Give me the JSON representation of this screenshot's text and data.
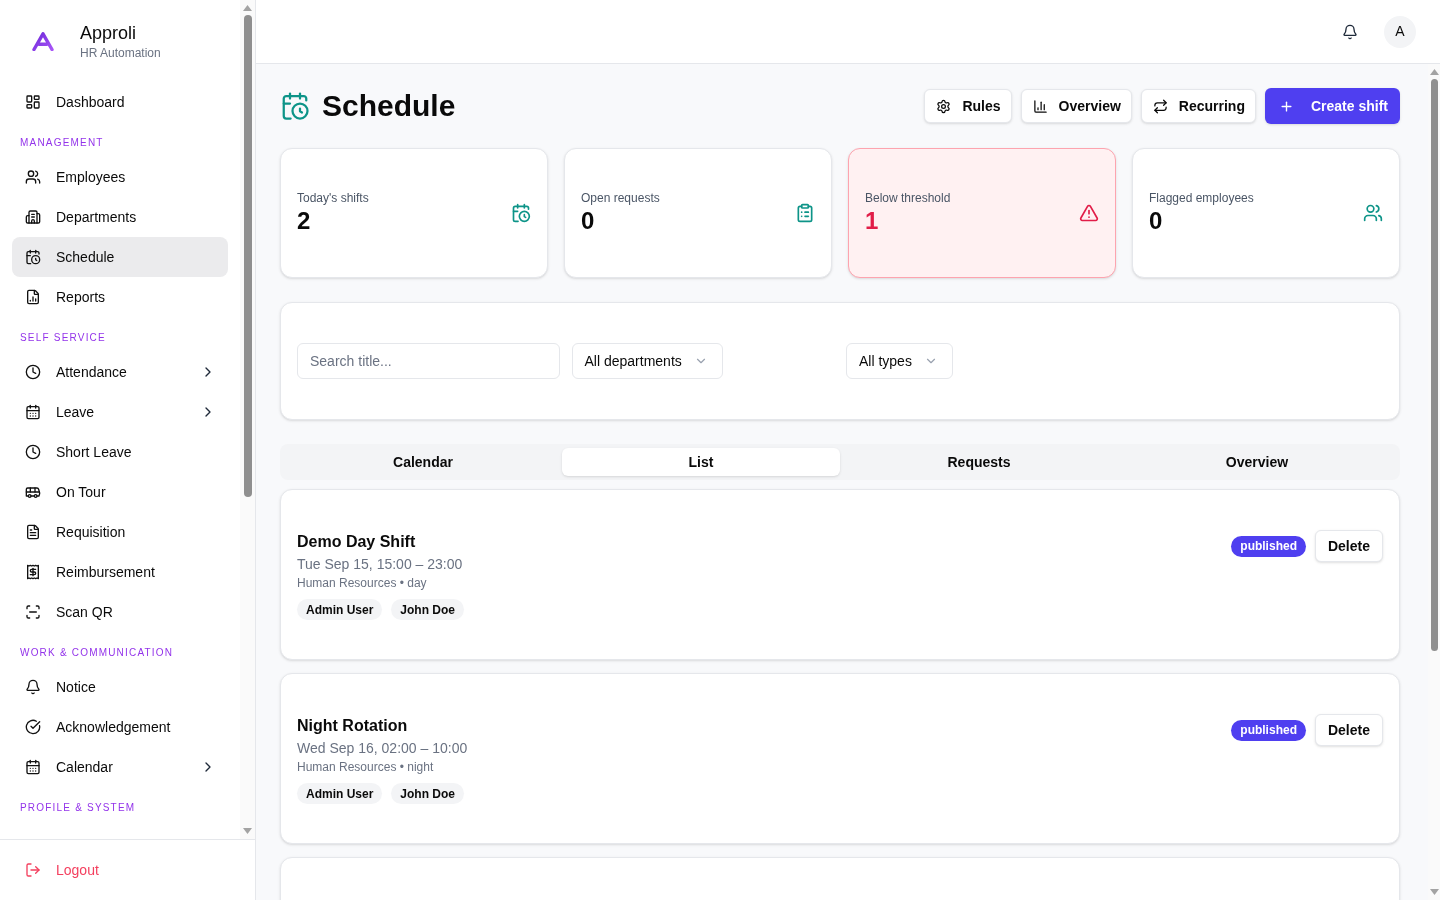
{
  "sidebar": {
    "brand": {
      "name": "Approli",
      "subtitle": "HR Automation"
    },
    "sections": [
      {
        "items": [
          {
            "label": "Dashboard",
            "selected": false,
            "expandable": false
          }
        ]
      },
      {
        "title": "MANAGEMENT",
        "items": [
          {
            "label": "Employees",
            "selected": false,
            "expandable": false
          },
          {
            "label": "Departments",
            "selected": false,
            "expandable": false
          },
          {
            "label": "Schedule",
            "selected": true,
            "expandable": false
          },
          {
            "label": "Reports",
            "selected": false,
            "expandable": false
          }
        ]
      },
      {
        "title": "SELF SERVICE",
        "items": [
          {
            "label": "Attendance",
            "selected": false,
            "expandable": true
          },
          {
            "label": "Leave",
            "selected": false,
            "expandable": true
          },
          {
            "label": "Short Leave",
            "selected": false,
            "expandable": false
          },
          {
            "label": "On Tour",
            "selected": false,
            "expandable": false
          },
          {
            "label": "Requisition",
            "selected": false,
            "expandable": false
          },
          {
            "label": "Reimbursement",
            "selected": false,
            "expandable": false
          },
          {
            "label": "Scan QR",
            "selected": false,
            "expandable": false
          }
        ]
      },
      {
        "title": "WORK & COMMUNICATION",
        "items": [
          {
            "label": "Notice",
            "selected": false,
            "expandable": false
          },
          {
            "label": "Acknowledgement",
            "selected": false,
            "expandable": false
          },
          {
            "label": "Calendar",
            "selected": false,
            "expandable": true
          }
        ]
      },
      {
        "title": "PROFILE & SYSTEM"
      }
    ],
    "logout": {
      "label": "Logout"
    }
  },
  "header": {
    "avatar": "A"
  },
  "page": {
    "title": "Schedule",
    "actions": [
      {
        "label": "Rules",
        "kind": "outline"
      },
      {
        "label": "Overview",
        "kind": "outline"
      },
      {
        "label": "Recurring",
        "kind": "outline"
      },
      {
        "label": "Create shift",
        "kind": "primary"
      }
    ]
  },
  "stats": [
    {
      "label": "Today's shifts",
      "value": "2",
      "alert": false
    },
    {
      "label": "Open requests",
      "value": "0",
      "alert": false
    },
    {
      "label": "Below threshold",
      "value": "1",
      "alert": true
    },
    {
      "label": "Flagged employees",
      "value": "0",
      "alert": false
    }
  ],
  "filters": {
    "search": {
      "placeholder": "Search title..."
    },
    "selects": [
      {
        "value": "All departments"
      },
      {
        "value": "All types"
      }
    ]
  },
  "tabs": [
    {
      "label": "Calendar",
      "selected": false
    },
    {
      "label": "List",
      "selected": true
    },
    {
      "label": "Requests",
      "selected": false
    },
    {
      "label": "Overview",
      "selected": false
    }
  ],
  "shifts": [
    {
      "title": "Demo Day Shift",
      "time": "Tue Sep 15, 15:00 – 23:00",
      "meta": "Human Resources • day",
      "assignees": [
        "Admin User",
        "John Doe"
      ],
      "status": "published",
      "action": "Delete"
    },
    {
      "title": "Night Rotation",
      "time": "Wed Sep 16, 02:00 – 10:00",
      "meta": "Human Resources • night",
      "assignees": [
        "Admin User",
        "John Doe"
      ],
      "status": "published",
      "action": "Delete"
    }
  ]
}
